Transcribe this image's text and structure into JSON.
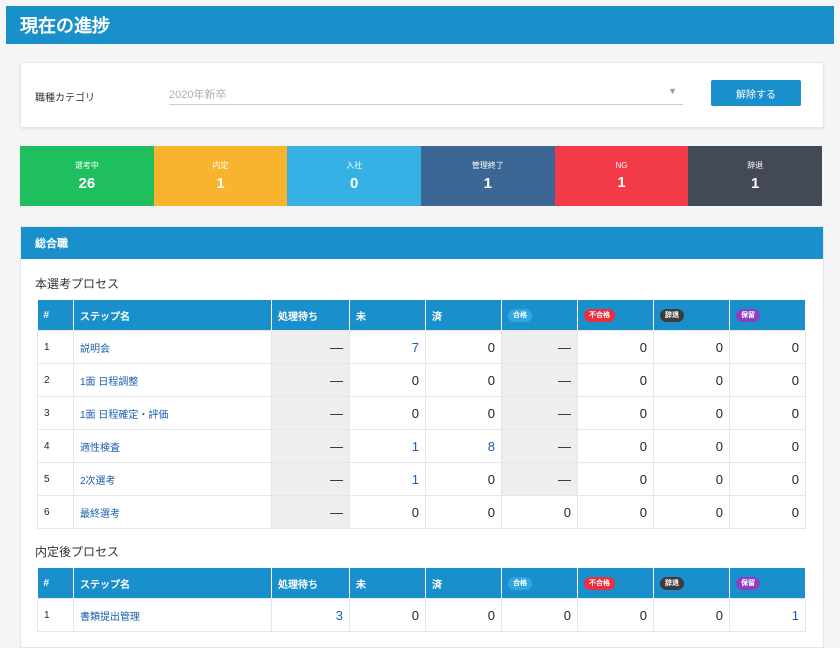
{
  "header": {
    "title": "現在の進捗"
  },
  "filter": {
    "label": "職種カテゴリ",
    "selected": "2020年新卒",
    "dropdown_icon": "▼",
    "clear_label": "解除する"
  },
  "stats": [
    {
      "label": "選考中",
      "value": "26",
      "color": "#1fbf5f"
    },
    {
      "label": "内定",
      "value": "1",
      "color": "#f8b42e"
    },
    {
      "label": "入社",
      "value": "0",
      "color": "#35b1e6"
    },
    {
      "label": "管理終了",
      "value": "1",
      "color": "#3c6694"
    },
    {
      "label": "NG",
      "value": "1",
      "color": "#f23a49"
    },
    {
      "label": "辞退",
      "value": "1",
      "color": "#434955"
    }
  ],
  "card": {
    "title": "総合職"
  },
  "headers": {
    "num": "#",
    "name": "ステップ名",
    "waiting": "処理待ち",
    "undone": "未",
    "done": "済",
    "pass": "合格",
    "fail": "不合格",
    "decline": "辞退",
    "hold": "保留"
  },
  "pill_colors": {
    "pass": "#2fa7e0",
    "fail": "#ea2f3f",
    "decline": "#3c3c3c",
    "hold": "#8e3fc0"
  },
  "sections": [
    {
      "title": "本選考プロセス",
      "rows": [
        {
          "num": "1",
          "name": "説明会",
          "waiting": "—",
          "undone": "7",
          "done": "0",
          "pass": "—",
          "fail": "0",
          "decline": "0",
          "hold": "0"
        },
        {
          "num": "2",
          "name": "1面 日程調整",
          "waiting": "—",
          "undone": "0",
          "done": "0",
          "pass": "—",
          "fail": "0",
          "decline": "0",
          "hold": "0"
        },
        {
          "num": "3",
          "name": "1面 日程確定・評価",
          "waiting": "—",
          "undone": "0",
          "done": "0",
          "pass": "—",
          "fail": "0",
          "decline": "0",
          "hold": "0"
        },
        {
          "num": "4",
          "name": "適性検査",
          "waiting": "—",
          "undone": "1",
          "done": "8",
          "pass": "—",
          "fail": "0",
          "decline": "0",
          "hold": "0"
        },
        {
          "num": "5",
          "name": "2次選考",
          "waiting": "—",
          "undone": "1",
          "done": "0",
          "pass": "—",
          "fail": "0",
          "decline": "0",
          "hold": "0"
        },
        {
          "num": "6",
          "name": "最終選考",
          "waiting": "—",
          "undone": "0",
          "done": "0",
          "pass": "0",
          "fail": "0",
          "decline": "0",
          "hold": "0"
        }
      ]
    },
    {
      "title": "内定後プロセス",
      "rows": [
        {
          "num": "1",
          "name": "書類提出管理",
          "waiting": "3",
          "undone": "0",
          "done": "0",
          "pass": "0",
          "fail": "0",
          "decline": "0",
          "hold": "1"
        }
      ]
    }
  ]
}
